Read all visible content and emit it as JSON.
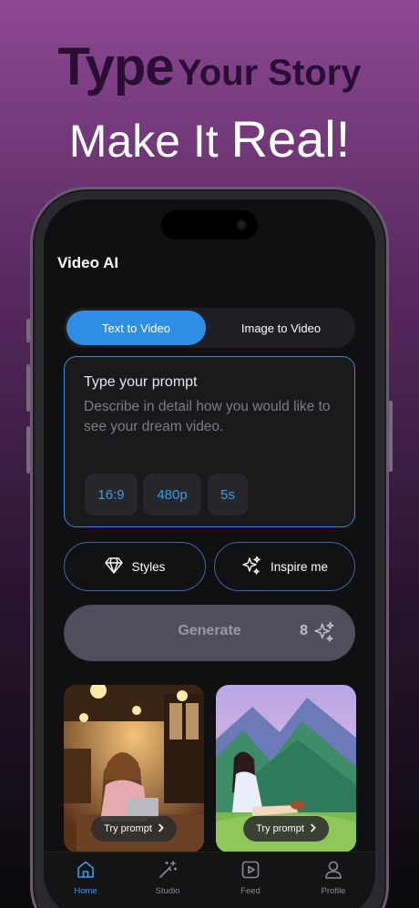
{
  "hero": {
    "line1_big": "Type",
    "line1_small": "Your Story",
    "line2_main": "Make It",
    "line2_big": "Real!"
  },
  "app": {
    "title": "Video AI"
  },
  "mode_tabs": {
    "active": "Text to Video",
    "inactive": "Image to Video"
  },
  "prompt": {
    "title": "Type your prompt",
    "placeholder": "Describe in detail how you would like to see your dream video.",
    "chips": [
      "16:9",
      "480p",
      "5s"
    ]
  },
  "actions": {
    "styles_label": "Styles",
    "inspire_label": "Inspire me"
  },
  "generate": {
    "label": "Generate",
    "credits": "8"
  },
  "examples": [
    {
      "button": "Try prompt",
      "icon": "chevron-right-icon"
    },
    {
      "button": "Try prompt",
      "icon": "chevron-right-icon"
    }
  ],
  "tabbar": {
    "items": [
      {
        "label": "Home",
        "icon": "home-icon",
        "active": true
      },
      {
        "label": "Studio",
        "icon": "magic-wand-icon",
        "active": false
      },
      {
        "label": "Feed",
        "icon": "play-square-icon",
        "active": false
      },
      {
        "label": "Profile",
        "icon": "user-icon",
        "active": false
      }
    ]
  },
  "colors": {
    "accent": "#2f8ee4",
    "background_top": "#8d4893",
    "screen_bg": "#101012",
    "generate_bg": "#4e4e5c"
  }
}
